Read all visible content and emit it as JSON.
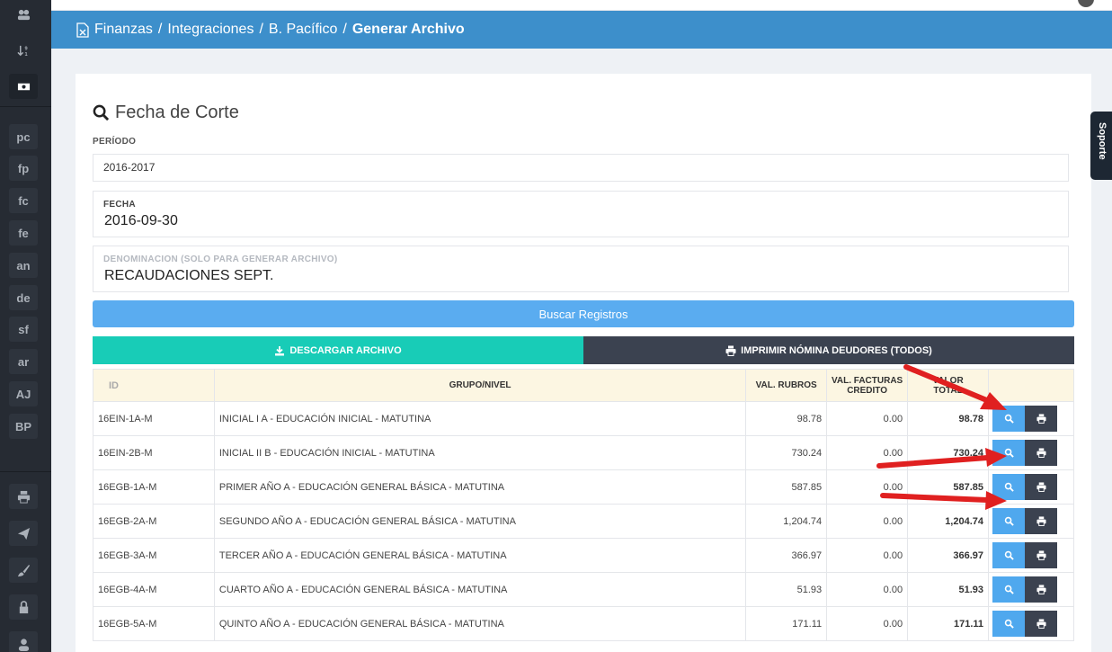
{
  "sidebar": {
    "items": [
      {
        "icon": "users-icon"
      },
      {
        "icon": "sort-icon"
      },
      {
        "icon": "money-icon"
      },
      {
        "label": "pc"
      },
      {
        "label": "fp"
      },
      {
        "label": "fc"
      },
      {
        "label": "fe"
      },
      {
        "label": "an"
      },
      {
        "label": "de"
      },
      {
        "label": "sf"
      },
      {
        "label": "ar"
      },
      {
        "label": "AJ"
      },
      {
        "label": "BP"
      },
      {
        "icon": "print-icon"
      },
      {
        "icon": "send-icon"
      },
      {
        "icon": "brush-icon"
      },
      {
        "icon": "lock-icon"
      },
      {
        "icon": "user-icon"
      }
    ]
  },
  "breadcrumb": {
    "items": [
      "Finanzas",
      "Integraciones",
      "B. Pacífico"
    ],
    "separator": "/",
    "current": "Generar Archivo"
  },
  "form": {
    "title": "Fecha de Corte",
    "periodo_label": "PERÍODO",
    "periodo_value": "2016-2017",
    "fecha_label": "FECHA",
    "fecha_value": "2016-09-30",
    "denominacion_label": "DENOMINACION (SOLO PARA GENERAR ARCHIVO)",
    "denominacion_value": "RECAUDACIONES SEPT."
  },
  "buttons": {
    "buscar": "Buscar Registros",
    "descargar": "DESCARGAR ARCHIVO",
    "imprimir": "IMPRIMIR NÓMINA DEUDORES (TODOS)"
  },
  "table": {
    "headers": {
      "id": "ID",
      "grupo": "GRUPO/NIVEL",
      "rubros": "VAL. RUBROS",
      "facturas_1": "VAL. FACTURAS",
      "facturas_2": "CREDITO",
      "total_1": "VALOR",
      "total_2": "TOTAL"
    },
    "rows": [
      {
        "id": "16EIN-1A-M",
        "grupo": "INICIAL I A - EDUCACIÓN INICIAL - MATUTINA",
        "rubros": "98.78",
        "facturas": "0.00",
        "total": "98.78"
      },
      {
        "id": "16EIN-2B-M",
        "grupo": "INICIAL II B - EDUCACIÓN INICIAL - MATUTINA",
        "rubros": "730.24",
        "facturas": "0.00",
        "total": "730.24"
      },
      {
        "id": "16EGB-1A-M",
        "grupo": "PRIMER AÑO A - EDUCACIÓN GENERAL BÁSICA - MATUTINA",
        "rubros": "587.85",
        "facturas": "0.00",
        "total": "587.85"
      },
      {
        "id": "16EGB-2A-M",
        "grupo": "SEGUNDO AÑO A - EDUCACIÓN GENERAL BÁSICA - MATUTINA",
        "rubros": "1,204.74",
        "facturas": "0.00",
        "total": "1,204.74"
      },
      {
        "id": "16EGB-3A-M",
        "grupo": "TERCER AÑO A - EDUCACIÓN GENERAL BÁSICA - MATUTINA",
        "rubros": "366.97",
        "facturas": "0.00",
        "total": "366.97"
      },
      {
        "id": "16EGB-4A-M",
        "grupo": "CUARTO AÑO A - EDUCACIÓN GENERAL BÁSICA - MATUTINA",
        "rubros": "51.93",
        "facturas": "0.00",
        "total": "51.93"
      },
      {
        "id": "16EGB-5A-M",
        "grupo": "QUINTO AÑO A - EDUCACIÓN GENERAL BÁSICA - MATUTINA",
        "rubros": "171.11",
        "facturas": "0.00",
        "total": "171.11"
      }
    ]
  },
  "support_tab": "Soporte",
  "colors": {
    "breadcrumb_bg": "#3d8fcb",
    "search_btn": "#5aacf0",
    "download_btn": "#18ccb7",
    "print_btn": "#3b4250",
    "annotation_arrow": "#e02020"
  }
}
